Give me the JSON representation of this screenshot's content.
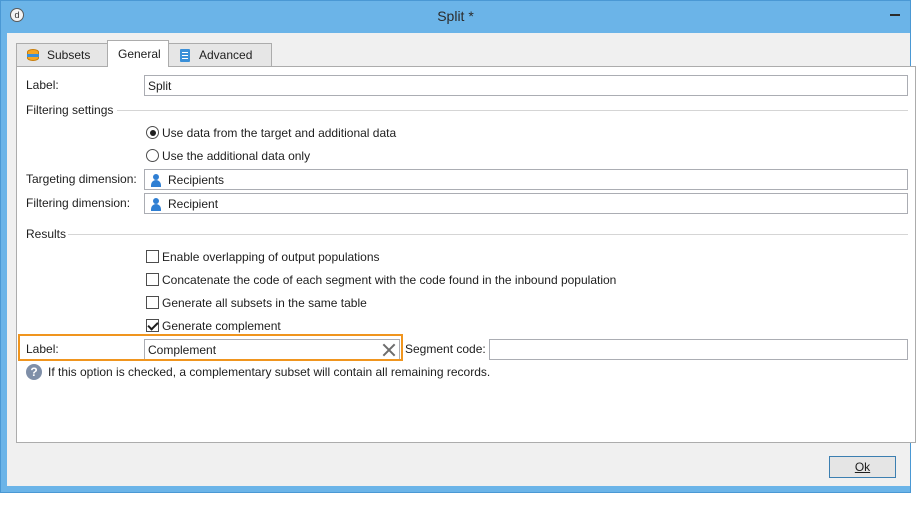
{
  "window": {
    "title": "Split *"
  },
  "tabs": [
    {
      "label": "Subsets",
      "icon": "database-icon"
    },
    {
      "label": "General",
      "active": true
    },
    {
      "label": "Advanced",
      "icon": "clipboard-icon"
    }
  ],
  "general": {
    "label_caption": "Label:",
    "label_value": "Split",
    "filtering_settings": "Filtering settings",
    "radio_options": [
      {
        "label": "Use data from the target and additional data",
        "checked": true
      },
      {
        "label": "Use the additional data only",
        "checked": false
      }
    ],
    "targeting_dimension_caption": "Targeting dimension:",
    "targeting_dimension_value": "Recipients",
    "filtering_dimension_caption": "Filtering dimension:",
    "filtering_dimension_value": "Recipient"
  },
  "results": {
    "header": "Results",
    "checkboxes": [
      {
        "label": "Enable overlapping of output populations",
        "checked": false
      },
      {
        "label": "Concatenate the code of each segment with the code found in the inbound population",
        "checked": false
      },
      {
        "label": "Generate all subsets in the same table",
        "checked": false
      },
      {
        "label": "Generate complement",
        "checked": true
      }
    ],
    "complement_label_caption": "Label:",
    "complement_label_value": "Complement",
    "segment_code_caption": "Segment code:",
    "segment_code_value": "",
    "help_text": "If this option is checked, a complementary subset will contain all remaining records."
  },
  "buttons": {
    "ok": "Ok"
  },
  "colors": {
    "titlebar": "#6bb4e8",
    "highlight": "#f0951e",
    "accent": "#2f7fd3"
  }
}
